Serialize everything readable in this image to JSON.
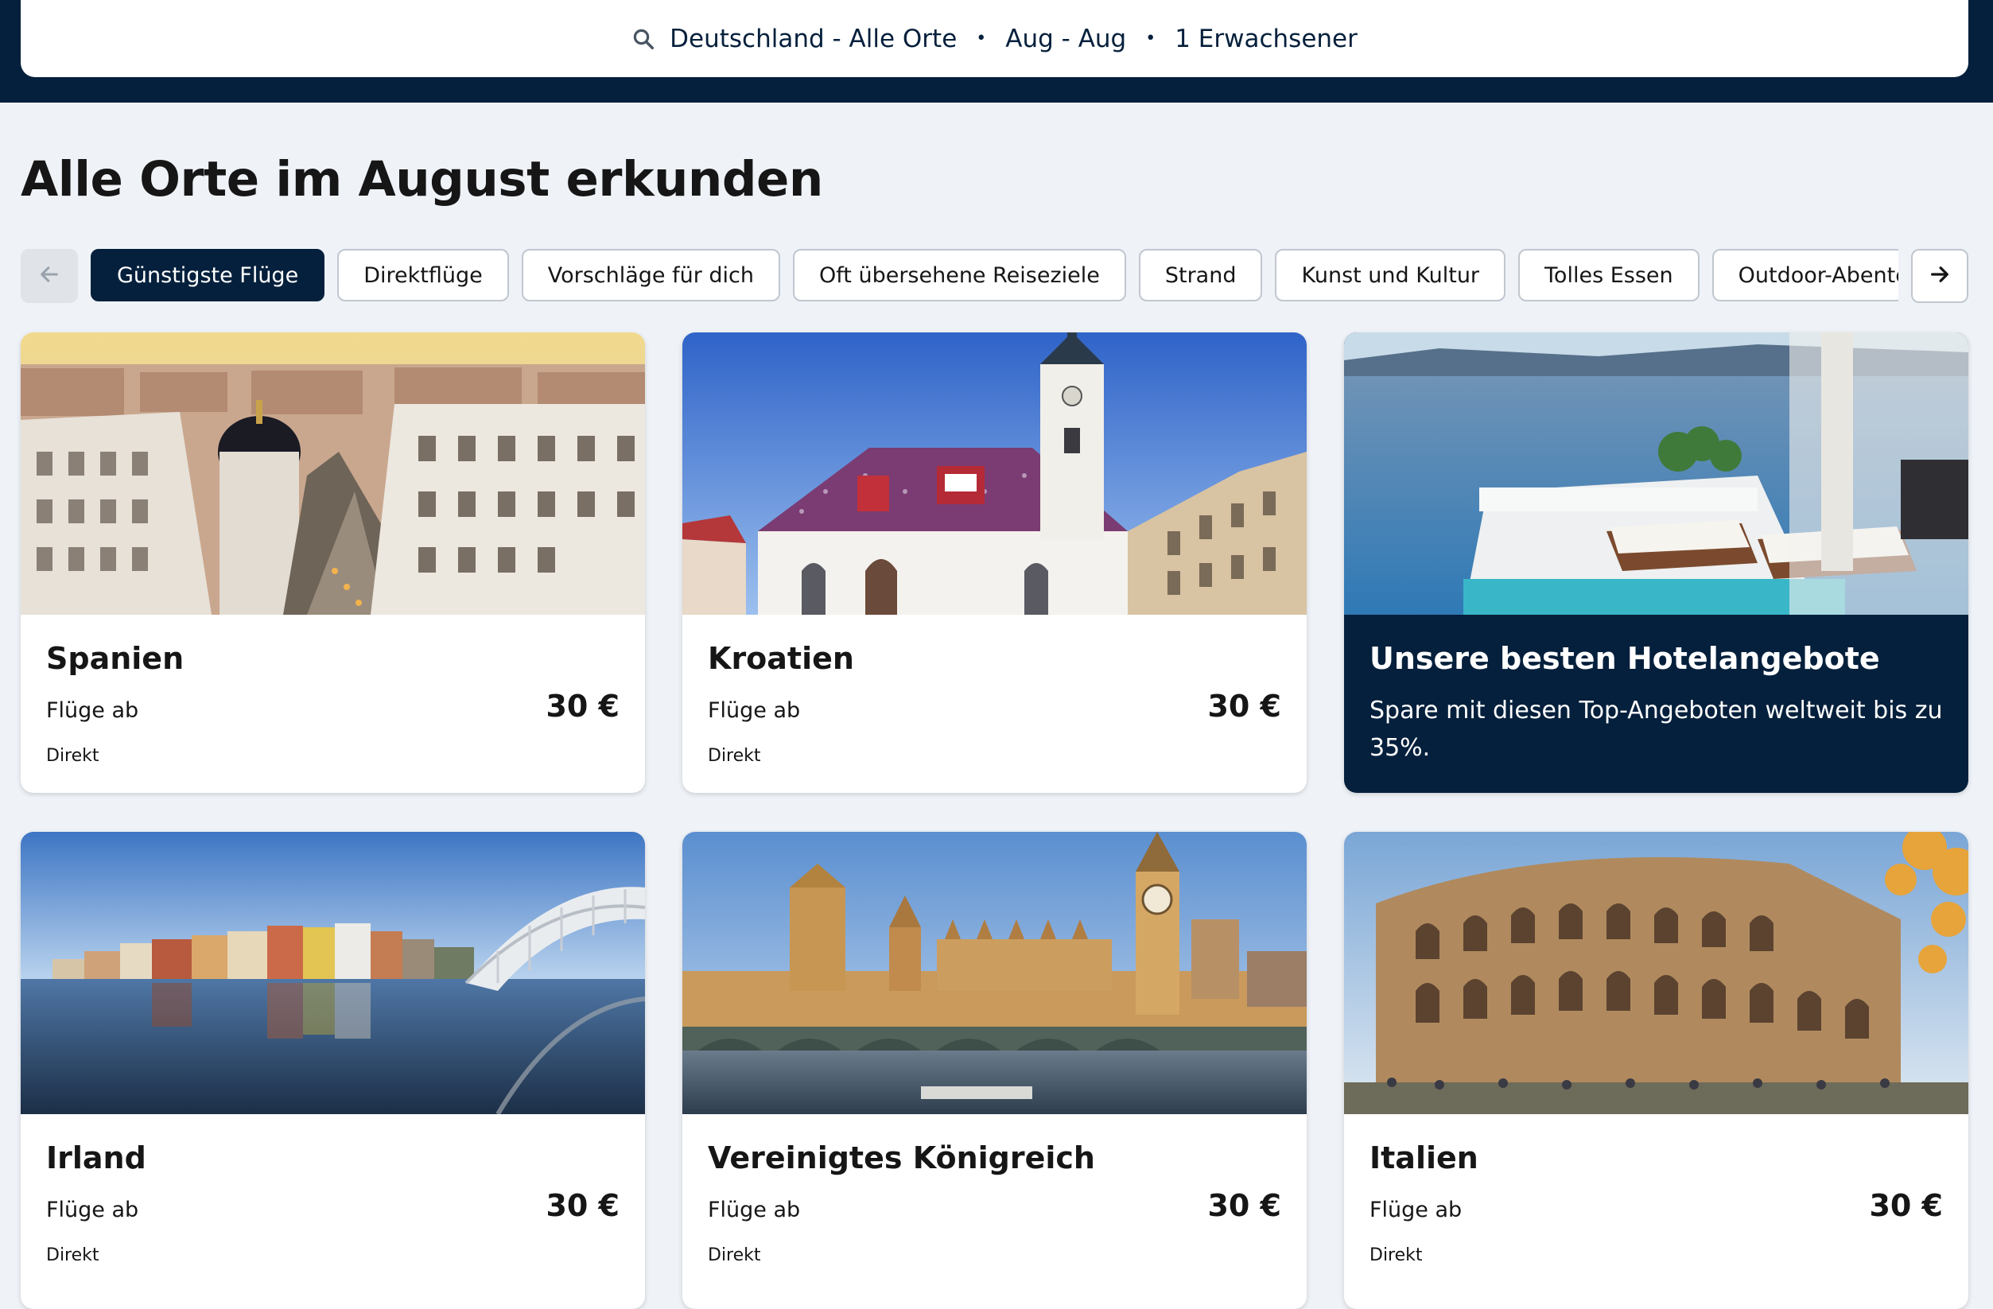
{
  "search_summary": {
    "destination": "Deutschland - Alle Orte",
    "dates": "Aug - Aug",
    "travellers": "1 Erwachsener",
    "separator": "•",
    "icon": "search-icon"
  },
  "page_title": "Alle Orte im August erkunden",
  "filters": {
    "prev_icon": "arrow-left-icon",
    "next_icon": "arrow-right-icon",
    "chips": [
      {
        "label": "Günstigste Flüge",
        "active": true
      },
      {
        "label": "Direktflüge",
        "active": false
      },
      {
        "label": "Vorschläge für dich",
        "active": false
      },
      {
        "label": "Oft übersehene Reiseziele",
        "active": false
      },
      {
        "label": "Strand",
        "active": false
      },
      {
        "label": "Kunst und Kultur",
        "active": false
      },
      {
        "label": "Tolles Essen",
        "active": false
      },
      {
        "label": "Outdoor-Abenteuer",
        "active": false
      },
      {
        "label": "",
        "active": false
      }
    ]
  },
  "cards": [
    {
      "name": "Spanien",
      "flights_from": "Flüge ab",
      "price": "30 €",
      "direct": "Direkt"
    },
    {
      "name": "Kroatien",
      "flights_from": "Flüge ab",
      "price": "30 €",
      "direct": "Direkt"
    },
    {
      "name": "Irland",
      "flights_from": "Flüge ab",
      "price": "30 €",
      "direct": "Direkt"
    },
    {
      "name": "Vereinigtes Königreich",
      "flights_from": "Flüge ab",
      "price": "30 €",
      "direct": "Direkt"
    },
    {
      "name": "Italien",
      "flights_from": "Flüge ab",
      "price": "30 €",
      "direct": "Direkt"
    }
  ],
  "promo": {
    "title": "Unsere besten Hotelangebote",
    "text": "Spare mit diesen Top-Angeboten weltweit bis zu 35%."
  },
  "colors": {
    "brand_dark": "#05203c",
    "page_background": "#eff3f8",
    "chip_border": "#c1c7cf"
  }
}
